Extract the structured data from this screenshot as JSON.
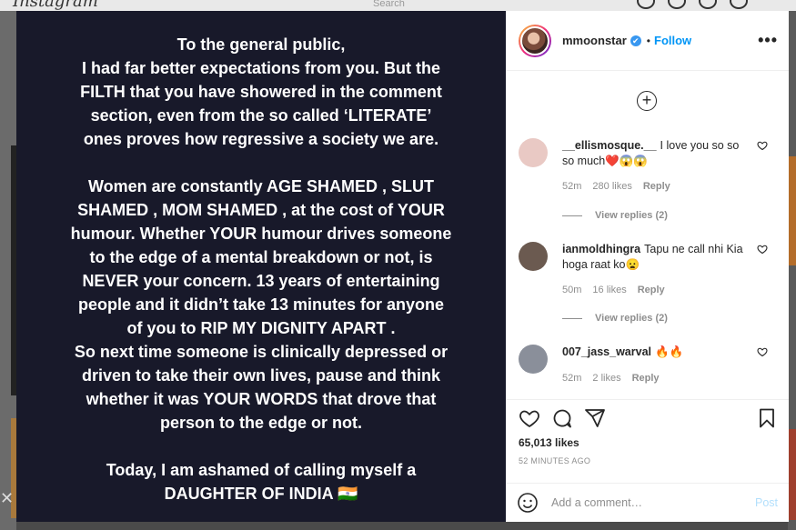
{
  "background": {
    "logo": "Instagram",
    "search_placeholder": "Search"
  },
  "post": {
    "paragraphs": [
      [
        "To the general public,",
        "I had far better expectations from you. But the",
        "FILTH that you have showered in the comment",
        "section, even from the so called ‘LITERATE’",
        "ones proves how regressive a society we are."
      ],
      [
        "Women are constantly AGE SHAMED , SLUT",
        "SHAMED , MOM SHAMED , at the cost of YOUR",
        "humour. Whether YOUR humour drives someone",
        "to the edge of a mental breakdown or not, is",
        "NEVER your concern. 13 years of entertaining",
        "people and it didn’t take 13 minutes for anyone",
        "of you to RIP MY DIGNITY APART .",
        "So next time someone is clinically depressed or",
        "driven to take their own lives, pause and think",
        "whether it was YOUR WORDS that drove that",
        "person to the edge or not."
      ],
      [
        "Today, I am ashamed of calling myself a",
        "DAUGHTER OF INDIA 🇮🇳"
      ]
    ]
  },
  "header": {
    "username": "mmoonstar",
    "verified_mark": "✔",
    "separator": "•",
    "follow_label": "Follow",
    "more_label": "•••"
  },
  "load_more_label": "+",
  "comments": [
    {
      "user": "__ellismosque.__",
      "text": "I love you so so so much❤️😱😱",
      "time": "52m",
      "likes": "280 likes",
      "reply": "Reply",
      "view_replies": "View replies (2)",
      "avatar_color": "#e9c9c4"
    },
    {
      "user": "ianmoldhingra",
      "text": "Tapu ne call nhi Kia hoga raat ko😦",
      "time": "50m",
      "likes": "16 likes",
      "reply": "Reply",
      "view_replies": "View replies (2)",
      "avatar_color": "#6b5a50"
    },
    {
      "user": "007_jass_warval",
      "text": "🔥🔥",
      "time": "52m",
      "likes": "2 likes",
      "reply": "Reply",
      "avatar_color": "#8a8f9a"
    }
  ],
  "stats": {
    "likes": "65,013 likes",
    "time_ago": "52 MINUTES AGO"
  },
  "add_comment": {
    "placeholder": "Add a comment…",
    "post_label": "Post"
  }
}
